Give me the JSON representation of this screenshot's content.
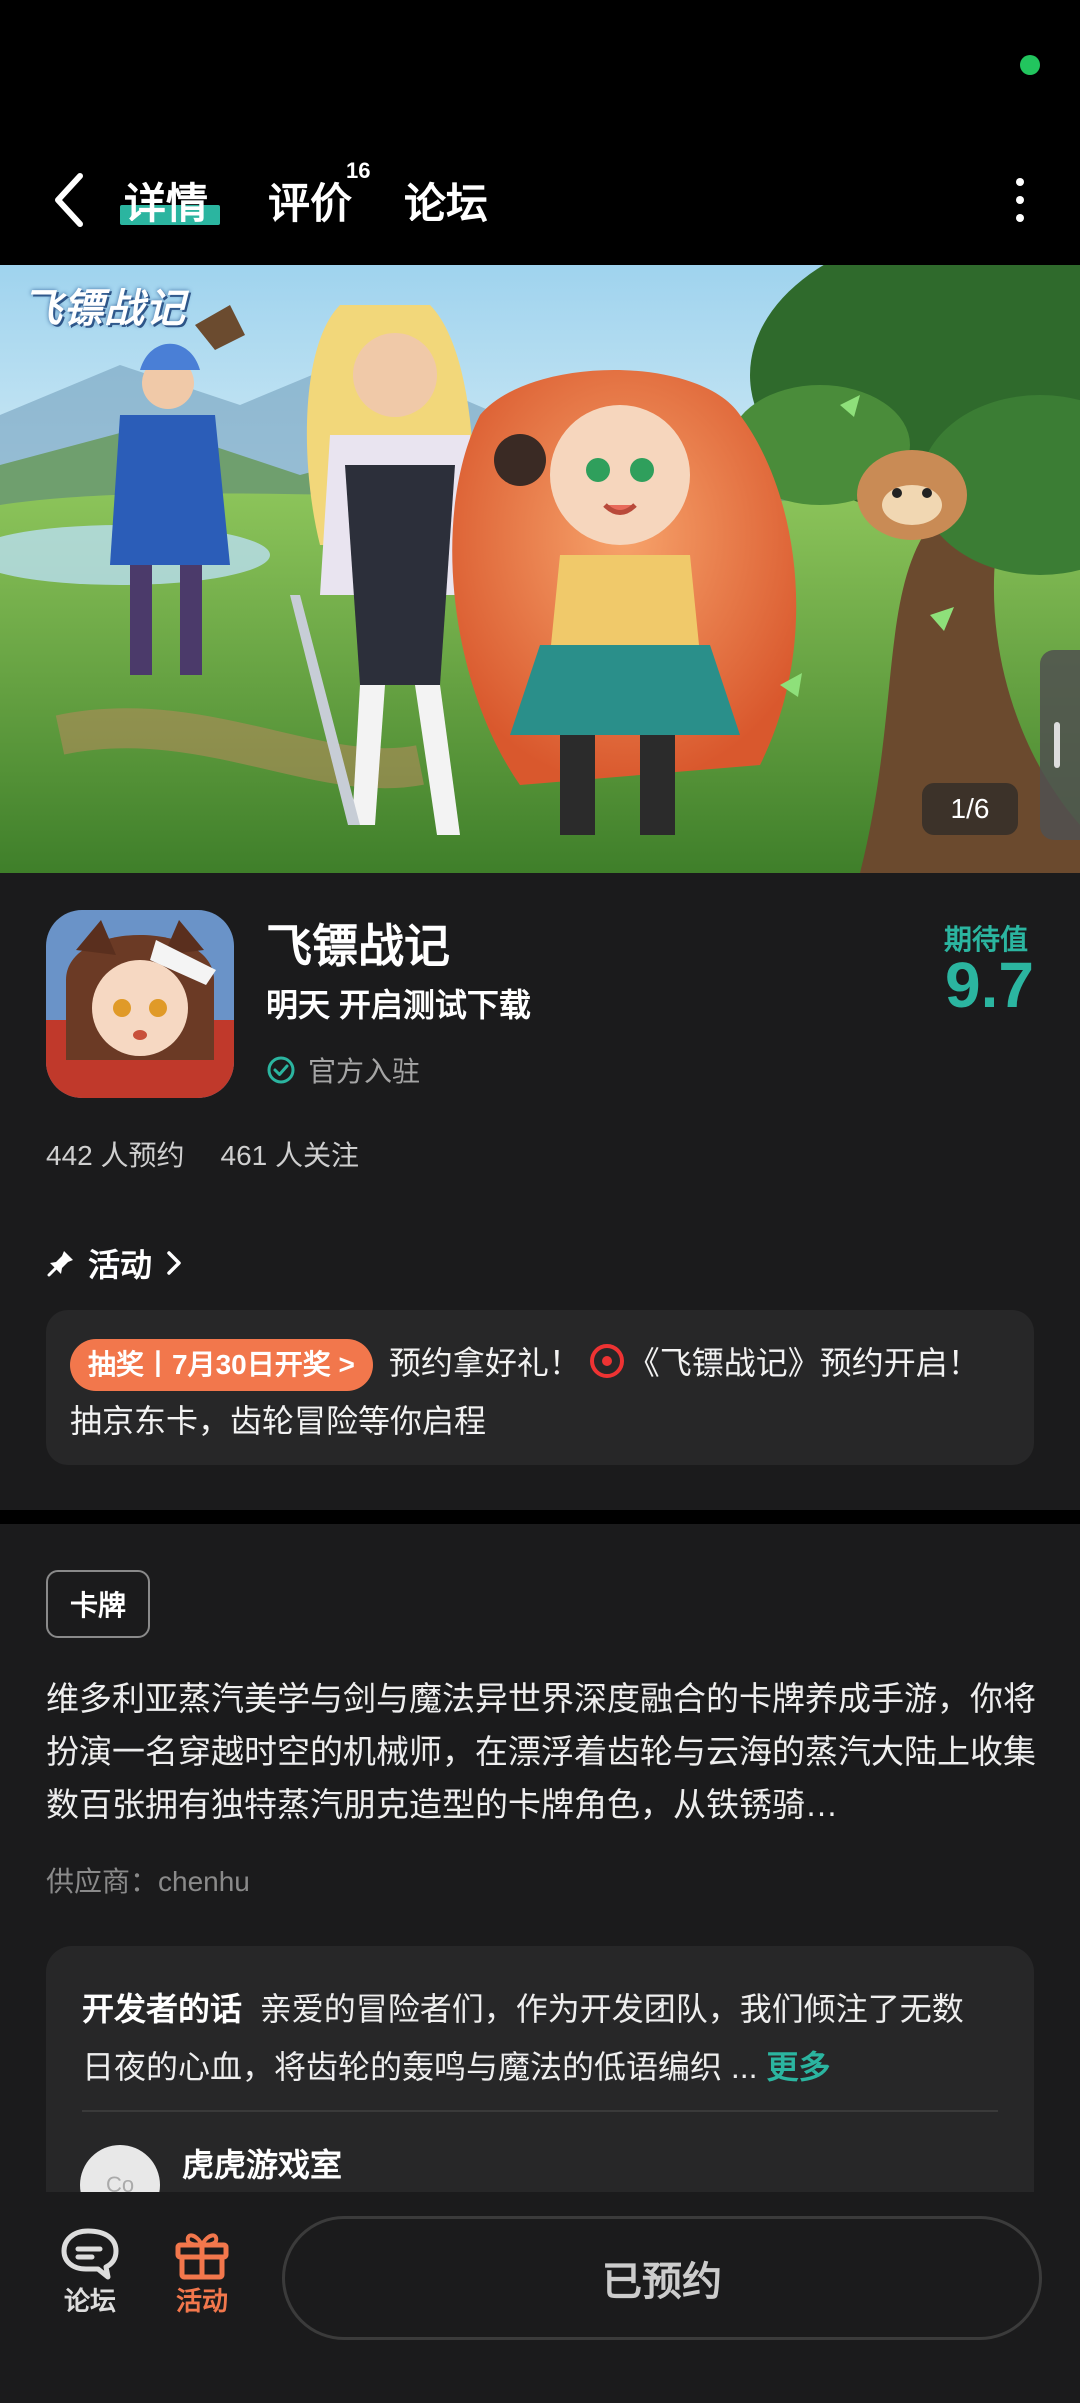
{
  "header": {
    "tabs": [
      {
        "label": "详情",
        "active": true
      },
      {
        "label": "评价",
        "count": "16"
      },
      {
        "label": "论坛"
      }
    ]
  },
  "hero": {
    "logo_text": "飞镖战记",
    "counter": "1/6"
  },
  "app": {
    "name": "飞镖战记",
    "status": "明天 开启测试下载",
    "official_label": "官方入驻",
    "rating_label": "期待值",
    "rating_value": "9.7",
    "stats": {
      "reservations": "442 人预约",
      "followers": "461 人关注"
    }
  },
  "activity": {
    "title": "活动",
    "badge": "抽奖丨7月30日开奖 >",
    "text_before_icon": "预约拿好礼！",
    "text_after_icon": "《飞镖战记》预约开启！抽京东卡，齿轮冒险等你启程"
  },
  "details": {
    "genre_tag": "卡牌",
    "description": "维多利亚蒸汽美学与剑与魔法异世界深度融合的卡牌养成手游，你将扮演一名穿越时空的机械师，在漂浮着齿轮与云海的蒸汽大陆上收集数百张拥有独特蒸汽朋克造型的卡牌角色，从铁锈骑…",
    "supplier": "供应商：chenhu"
  },
  "developer": {
    "title": "开发者的话",
    "text": "亲爱的冒险者们，作为开发团队，我们倾注了无数日夜的心血，将齿轮的轰鸣与魔法的低语编织 ...",
    "more": "更多",
    "studio_name": "虎虎游戏室",
    "avatar_text": "Co"
  },
  "bottom_nav": {
    "forum_label": "论坛",
    "activity_label": "活动",
    "reserved_button": "已预约"
  },
  "colors": {
    "accent": "#2bb5a0",
    "orange": "#f2774c",
    "background": "#1b1b1c"
  }
}
